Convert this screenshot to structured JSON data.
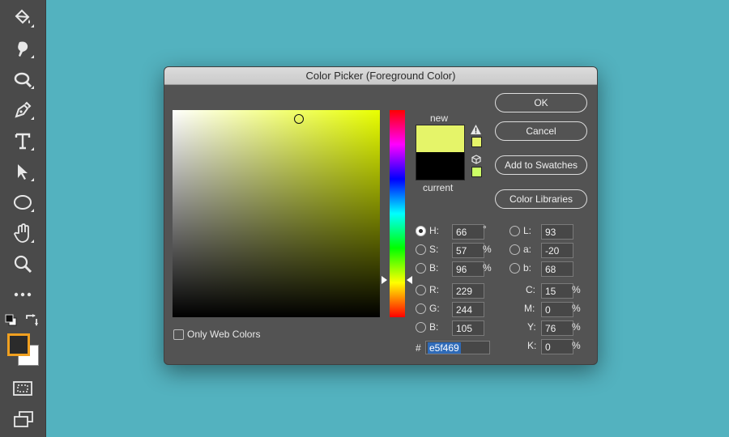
{
  "toolbar": {
    "tools": [
      "paint-bucket",
      "smudge",
      "dodge",
      "pen",
      "type",
      "path-selection",
      "ellipse",
      "hand",
      "zoom",
      "more",
      "default-colors",
      "swap-colors",
      "foreground-color",
      "background-color",
      "quick-mask",
      "screen-mode"
    ],
    "foreground_color": "#2b2b2b",
    "background_color": "#ffffff",
    "active_highlight": "#f0a020"
  },
  "dialog": {
    "title": "Color Picker (Foreground Color)",
    "buttons": {
      "ok": "OK",
      "cancel": "Cancel",
      "add_to_swatches": "Add to Swatches",
      "color_libraries": "Color Libraries"
    },
    "preview": {
      "new_label": "new",
      "current_label": "current",
      "new_color": "#e5f469",
      "current_color": "#000000",
      "gamut_warning_swatch": "#e5f469",
      "web_safe_swatch": "#ccff66"
    },
    "hue_color": "#e9ff00",
    "only_web_colors_label": "Only Web Colors",
    "only_web_colors_checked": false,
    "hsb": {
      "h_label": "H:",
      "h": "66",
      "h_unit": "°",
      "s_label": "S:",
      "s": "57",
      "s_unit": "%",
      "b_label": "B:",
      "b": "96",
      "b_unit": "%"
    },
    "rgb": {
      "r_label": "R:",
      "r": "229",
      "g_label": "G:",
      "g": "244",
      "b_label": "B:",
      "b": "105"
    },
    "lab": {
      "l_label": "L:",
      "l": "93",
      "a_label": "a:",
      "a": "-20",
      "b_label": "b:",
      "b": "68"
    },
    "cmyk": {
      "c_label": "C:",
      "c": "15",
      "c_unit": "%",
      "m_label": "M:",
      "m": "0",
      "m_unit": "%",
      "y_label": "Y:",
      "y": "76",
      "y_unit": "%",
      "k_label": "K:",
      "k": "0",
      "k_unit": "%"
    },
    "hex_label": "#",
    "hex": "e5f469",
    "selected_mode": "H"
  }
}
